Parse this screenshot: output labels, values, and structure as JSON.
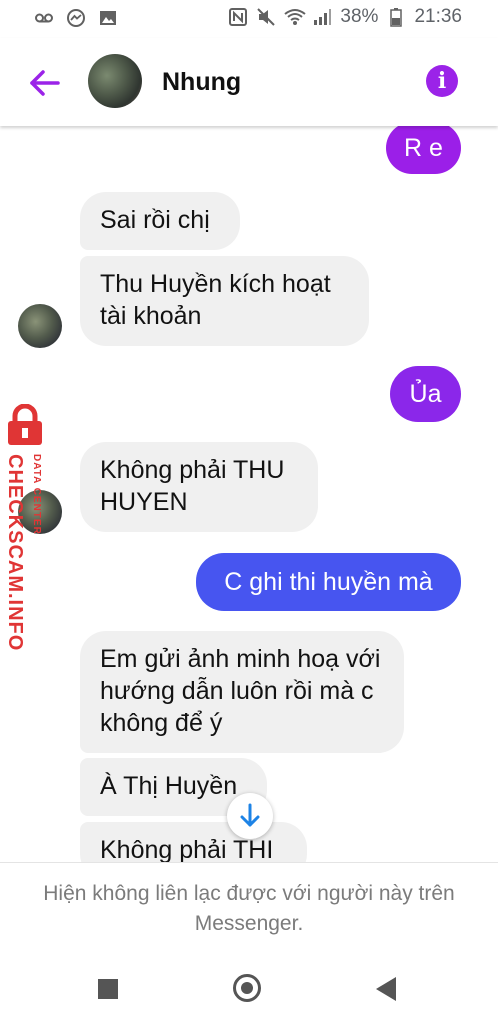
{
  "status_bar": {
    "icons_left": [
      "voicemail-icon",
      "messenger-icon",
      "gallery-icon"
    ],
    "icons_right": [
      "nfc-icon",
      "mute-icon",
      "wifi-icon",
      "signal-icon"
    ],
    "battery": "38%",
    "time": "21:36"
  },
  "header": {
    "contact_name": "Nhung",
    "info_glyph": "i",
    "accent_color": "#9b23e8"
  },
  "messages": [
    {
      "from": "me",
      "text": "R e"
    },
    {
      "from": "them",
      "text": "Sai rồi chị"
    },
    {
      "from": "them",
      "text": "Thu Huyền kích hoạt tài khoản"
    },
    {
      "from": "me",
      "text": "Ủa"
    },
    {
      "from": "them",
      "text": "Không phải THU HUYEN"
    },
    {
      "from": "me",
      "text": "C ghi thi huyền mà"
    },
    {
      "from": "them",
      "text": "Em gửi ảnh minh hoạ với hướng dẫn luôn rồi mà c không để ý"
    },
    {
      "from": "them",
      "text": "À Thị Huyền"
    },
    {
      "from": "them",
      "text": "Không phải THI"
    }
  ],
  "watermark": {
    "main": "CHECKSCAM.INFO",
    "sub": "DATA CENTER",
    "color": "#e03535"
  },
  "notice": {
    "text": "Hiện không liên lạc được với người này trên Messenger."
  },
  "colors": {
    "bubble_in": "#f0f0f0",
    "gradient_top": "#9b1fe8",
    "gradient_bottom": "#3b63f6"
  },
  "nav": {
    "icons": [
      "recent-apps-icon",
      "home-icon",
      "back-icon"
    ]
  }
}
